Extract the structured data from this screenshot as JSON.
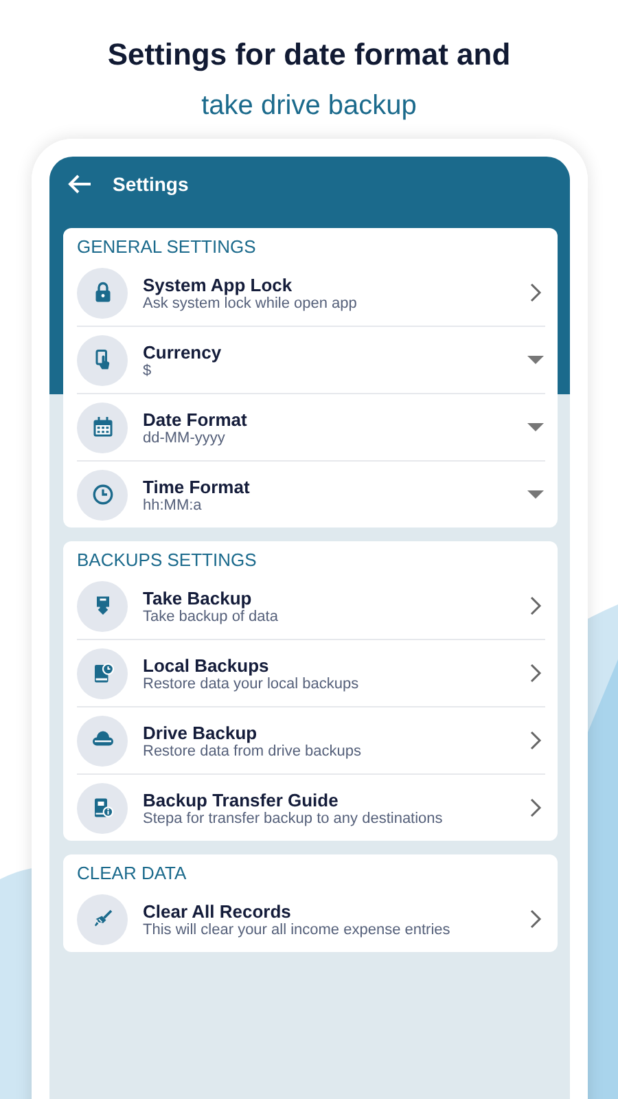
{
  "headline": {
    "title": "Settings for date format and",
    "subtitle": "take drive backup"
  },
  "toolbar": {
    "title": "Settings"
  },
  "sections": [
    {
      "title": "GENERAL SETTINGS",
      "items": [
        {
          "title": "System App Lock",
          "subtitle": "Ask system lock while open app",
          "kind": "link"
        },
        {
          "title": "Currency",
          "subtitle": "$",
          "kind": "dropdown"
        },
        {
          "title": "Date Format",
          "subtitle": "dd-MM-yyyy",
          "kind": "dropdown"
        },
        {
          "title": "Time Format",
          "subtitle": "hh:MM:a",
          "kind": "dropdown"
        }
      ]
    },
    {
      "title": "BACKUPS SETTINGS",
      "items": [
        {
          "title": "Take Backup",
          "subtitle": "Take backup of data",
          "kind": "link"
        },
        {
          "title": "Local Backups",
          "subtitle": "Restore data your local backups",
          "kind": "link"
        },
        {
          "title": "Drive Backup",
          "subtitle": "Restore data from drive backups",
          "kind": "link"
        },
        {
          "title": "Backup Transfer Guide",
          "subtitle": "Stepa for transfer backup to any destinations",
          "kind": "link"
        }
      ]
    },
    {
      "title": "CLEAR DATA",
      "items": [
        {
          "title": "Clear All Records",
          "subtitle": "This will clear your all income expense entries",
          "kind": "link"
        }
      ]
    }
  ]
}
